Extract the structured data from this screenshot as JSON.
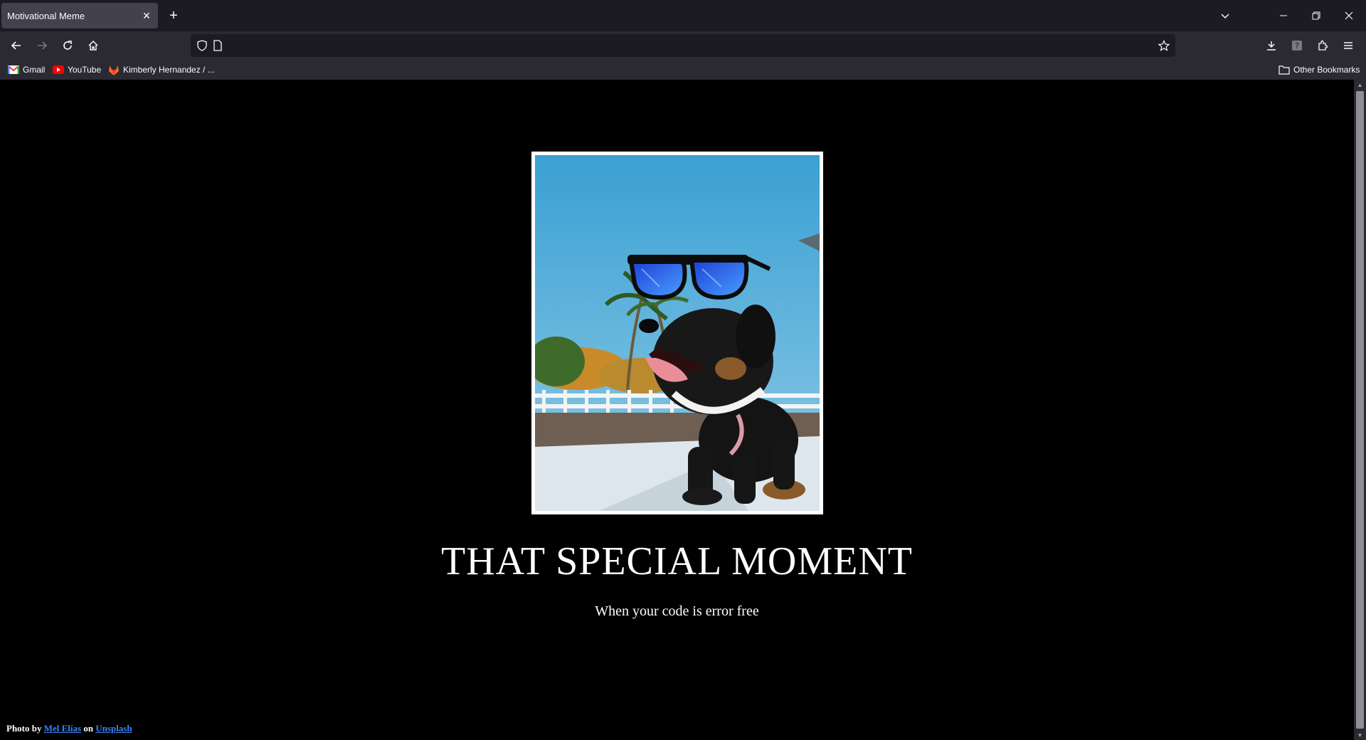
{
  "browser": {
    "tab_title": "Motivational Meme",
    "url": "",
    "bookmarks": [
      {
        "label": "Gmail",
        "icon": "gmail-icon"
      },
      {
        "label": "YouTube",
        "icon": "youtube-icon"
      },
      {
        "label": "Kimberly Hernandez / ...",
        "icon": "gitlab-icon"
      }
    ],
    "other_bookmarks": "Other Bookmarks"
  },
  "meme": {
    "image_alt": "Dog wearing blue sunglasses on a beach",
    "headline": "THAT SPECIAL MOMENT",
    "subline": "When your code is error free"
  },
  "credit": {
    "prefix": "Photo by",
    "author": "Mel Elías",
    "middle": "on",
    "site": "Unsplash"
  },
  "colors": {
    "page_bg": "#000000",
    "chrome_dark": "#1c1b22",
    "chrome": "#2b2a33",
    "link": "#3b82f6"
  }
}
